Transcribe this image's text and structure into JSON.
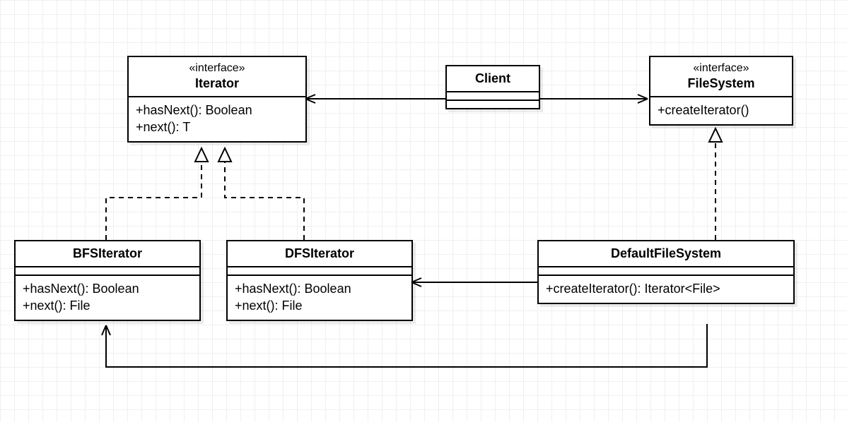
{
  "diagram": {
    "type": "uml-class",
    "classes": {
      "iterator": {
        "stereotype": "«interface»",
        "name": "Iterator",
        "ops": [
          "+hasNext(): Boolean",
          "+next(): T"
        ]
      },
      "client": {
        "name": "Client"
      },
      "filesystem": {
        "stereotype": "«interface»",
        "name": "FileSystem",
        "ops": [
          "+createIterator()"
        ]
      },
      "bfs": {
        "name": "BFSIterator",
        "ops": [
          "+hasNext(): Boolean",
          "+next(): File"
        ]
      },
      "dfs": {
        "name": "DFSIterator",
        "ops": [
          "+hasNext(): Boolean",
          "+next(): File"
        ]
      },
      "defaultfs": {
        "name": "DefaultFileSystem",
        "ops": [
          "+createIterator(): Iterator<File>"
        ]
      }
    },
    "relationships": [
      {
        "kind": "association-arrow",
        "from": "Client",
        "to": "Iterator"
      },
      {
        "kind": "association-arrow",
        "from": "Client",
        "to": "FileSystem"
      },
      {
        "kind": "realization",
        "from": "BFSIterator",
        "to": "Iterator"
      },
      {
        "kind": "realization",
        "from": "DFSIterator",
        "to": "Iterator"
      },
      {
        "kind": "realization",
        "from": "DefaultFileSystem",
        "to": "FileSystem"
      },
      {
        "kind": "association-arrow",
        "from": "DefaultFileSystem",
        "to": "DFSIterator"
      },
      {
        "kind": "association-arrow",
        "from": "DefaultFileSystem",
        "to": "BFSIterator"
      }
    ]
  }
}
